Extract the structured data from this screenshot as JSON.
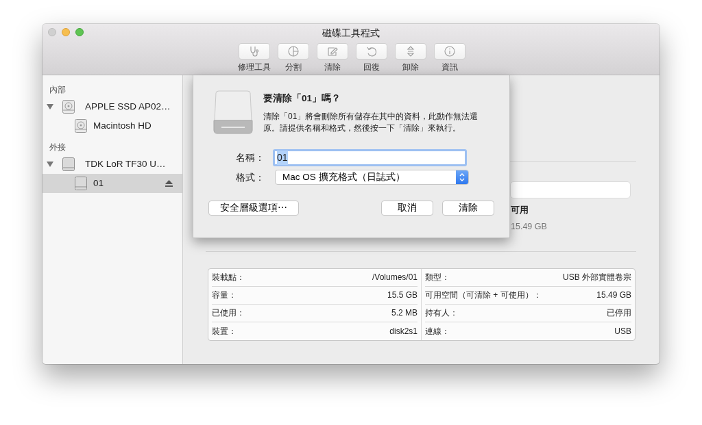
{
  "window": {
    "title": "磁碟工具程式"
  },
  "toolbar": [
    {
      "label": "修理工具"
    },
    {
      "label": "分割"
    },
    {
      "label": "清除"
    },
    {
      "label": "回復"
    },
    {
      "label": "卸除"
    },
    {
      "label": "資訊"
    }
  ],
  "sidebar": {
    "sections": [
      {
        "heading": "內部",
        "items": [
          {
            "label": "APPLE SSD AP02…",
            "kind": "internal",
            "expanded": true,
            "selected": false,
            "ejectable": false,
            "children": [
              {
                "label": "Macintosh HD",
                "kind": "internal",
                "selected": false,
                "ejectable": false
              }
            ]
          }
        ]
      },
      {
        "heading": "外接",
        "items": [
          {
            "label": "TDK LoR TF30 U…",
            "kind": "external",
            "expanded": true,
            "selected": false,
            "ejectable": false,
            "children": [
              {
                "label": "01",
                "kind": "external",
                "selected": true,
                "ejectable": true
              }
            ]
          }
        ]
      }
    ]
  },
  "sheet": {
    "title": "要清除「01」嗎？",
    "message": "清除「01」將會刪除所有儲存在其中的資料，此動作無法還原。請提供名稱和格式，然後按一下「清除」來執行。",
    "name_label": "名稱：",
    "name_value": "01",
    "name_selected": true,
    "format_label": "格式：",
    "format_value": "Mac OS 擴充格式（日誌式）",
    "buttons": [
      {
        "label": "安全層級選項⋯"
      },
      {
        "label": "取消"
      },
      {
        "label": "清除"
      }
    ]
  },
  "usage": {
    "label": "可用",
    "value": "15.49 GB"
  },
  "info": {
    "columns": [
      [
        {
          "label": "裝載點：",
          "value": "/Volumes/01"
        },
        {
          "label": "容量：",
          "value": "15.5 GB"
        },
        {
          "label": "已使用：",
          "value": "5.2 MB"
        },
        {
          "label": "裝置：",
          "value": "disk2s1"
        }
      ],
      [
        {
          "label": "類型：",
          "value": "USB 外部實體卷宗"
        },
        {
          "label": "可用空間（可清除 + 可使用）：",
          "value": "15.49 GB"
        },
        {
          "label": "持有人：",
          "value": "已停用"
        },
        {
          "label": "連線：",
          "value": "USB"
        }
      ]
    ]
  }
}
